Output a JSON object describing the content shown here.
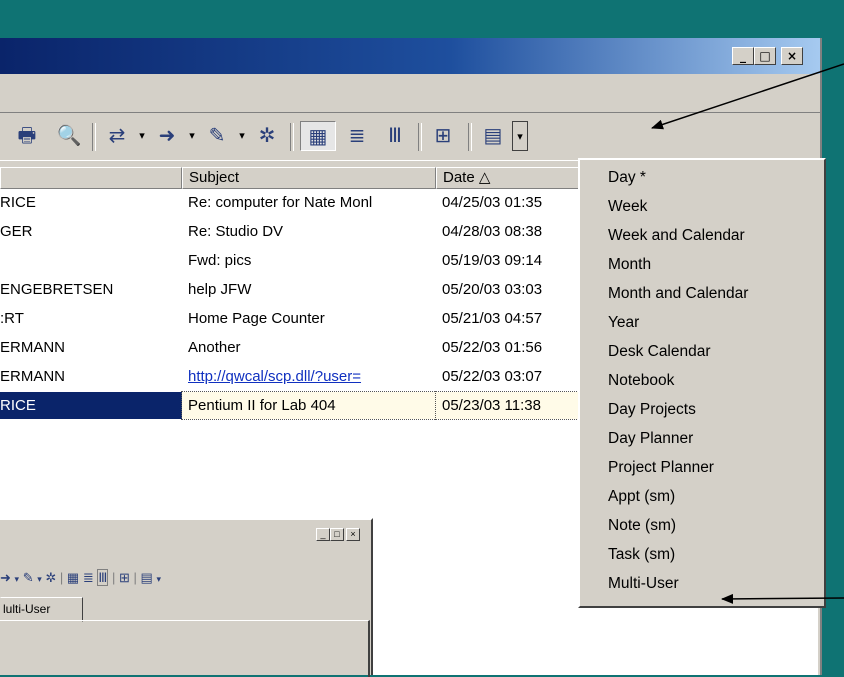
{
  "window": {
    "controls": [
      "_",
      "□",
      "×"
    ]
  },
  "toolbar": {
    "icons": [
      "print-icon",
      "find-icon",
      "send-receive-icon",
      "forward-icon",
      "edit-icon",
      "new-icon",
      "day-view-icon",
      "week-view-icon",
      "column-view-icon",
      "planner-icon",
      "calendar-view-icon"
    ]
  },
  "list": {
    "columns": [
      "Subject",
      "Date △"
    ],
    "rows": [
      {
        "from": "RICE",
        "subject": "Re: computer for Nate Monl",
        "date": "04/25/03 01:35"
      },
      {
        "from": "GER",
        "subject": "Re: Studio DV",
        "date": "04/28/03 08:38"
      },
      {
        "from": "",
        "subject": "Fwd: pics",
        "date": "05/19/03 09:14"
      },
      {
        "from": "ENGEBRETSEN",
        "subject": "help JFW",
        "date": "05/20/03 03:03"
      },
      {
        "from": ":RT",
        "subject": "Home Page Counter",
        "date": "05/21/03 04:57"
      },
      {
        "from": "ERMANN",
        "subject": "Another",
        "date": "05/22/03 01:56"
      },
      {
        "from": "ERMANN",
        "subject": "http://qwcal/scp.dll/?user=",
        "date": "05/22/03 03:07",
        "link": true
      },
      {
        "from": "RICE",
        "subject": "Pentium II for Lab 404",
        "date": "05/23/03 11:38",
        "selected": true
      }
    ]
  },
  "dropdown": {
    "items": [
      "Day *",
      "Week",
      "Week and Calendar",
      "Month",
      "Month and Calendar",
      "Year",
      "Desk Calendar",
      "Notebook",
      "Day Projects",
      "Day Planner",
      "Project Planner",
      "Appt (sm)",
      "Note (sm)",
      "Task (sm)",
      "Multi-User"
    ]
  },
  "subwindow": {
    "controls": [
      "_",
      "□",
      "×"
    ],
    "tab_label": "lulti-User"
  }
}
